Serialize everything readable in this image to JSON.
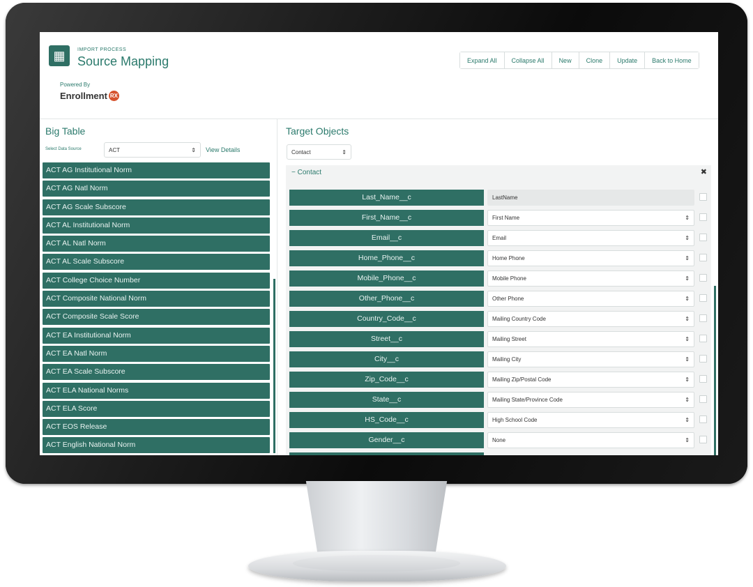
{
  "header": {
    "crumb": "IMPORT PROCESS",
    "title": "Source Mapping",
    "powered_by": "Powered By",
    "logo_text": "Enrollment",
    "logo_badge": "RX",
    "buttons": [
      "Expand All",
      "Collapse All",
      "New",
      "Clone",
      "Update",
      "Back to Home"
    ]
  },
  "left_panel": {
    "title": "Big Table",
    "data_source_label": "Select Data Source",
    "data_source_value": "ACT",
    "view_details": "View Details",
    "items": [
      "ACT AG Institutional Norm",
      "ACT AG Natl Norm",
      "ACT AG Scale Subscore",
      "ACT AL Institutional Norm",
      "ACT AL Natl Norm",
      "ACT AL Scale Subscore",
      "ACT College Choice Number",
      "ACT Composite National Norm",
      "ACT Composite Scale Score",
      "ACT EA Institutional Norm",
      "ACT EA Natl Norm",
      "ACT EA Scale Subscore",
      "ACT ELA National Norms",
      "ACT ELA Score",
      "ACT EOS Release",
      "ACT English National Norm"
    ]
  },
  "right_panel": {
    "title": "Target Objects",
    "object_select_value": "Contact",
    "section_title": "Contact",
    "collapse_symbol": "−",
    "close_symbol": "✖",
    "mappings": [
      {
        "field": "Last_Name__c",
        "target": "LastName"
      },
      {
        "field": "First_Name__c",
        "target": "First Name"
      },
      {
        "field": "Email__c",
        "target": "Email"
      },
      {
        "field": "Home_Phone__c",
        "target": "Home Phone"
      },
      {
        "field": "Mobile_Phone__c",
        "target": "Mobile Phone"
      },
      {
        "field": "Other_Phone__c",
        "target": "Other Phone"
      },
      {
        "field": "Country_Code__c",
        "target": "Mailing Country Code"
      },
      {
        "field": "Street__c",
        "target": "Mailing Street"
      },
      {
        "field": "City__c",
        "target": "Mailing City"
      },
      {
        "field": "Zip_Code__c",
        "target": "Mailing Zip/Postal Code"
      },
      {
        "field": "State__c",
        "target": "Mailing State/Province Code"
      },
      {
        "field": "HS_Code__c",
        "target": "High School Code"
      },
      {
        "field": "Gender__c",
        "target": "None"
      }
    ]
  },
  "icons": {
    "app_icon": "map-icon",
    "select_arrow": "⇕"
  },
  "colors": {
    "accent": "#2f6f64",
    "link": "#2b7a6c",
    "bezel": "#111111"
  }
}
